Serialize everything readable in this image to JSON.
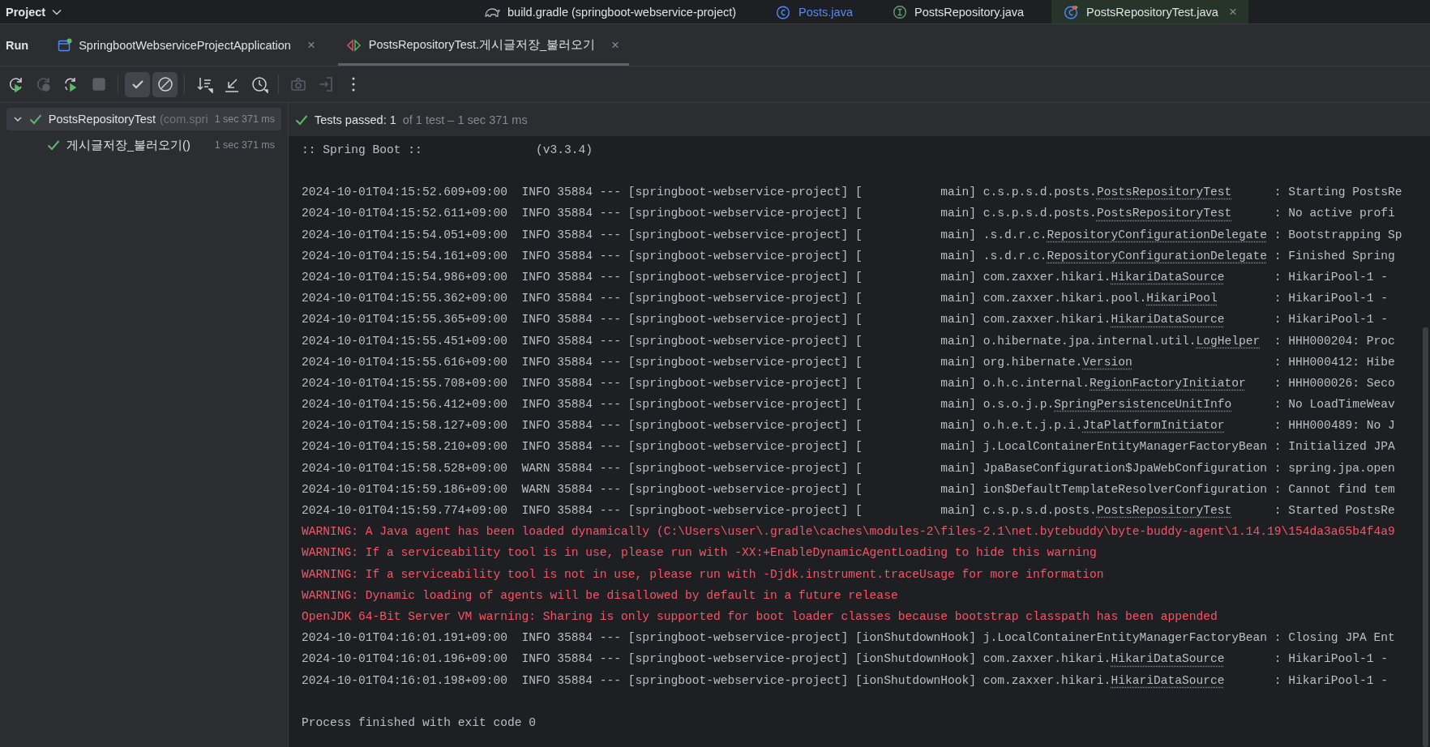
{
  "top_bar": {
    "project_label": "Project"
  },
  "editor_tabs": [
    {
      "label": "build.gradle (springboot-webservice-project)",
      "kind": "gradle",
      "selected": false,
      "link": false
    },
    {
      "label": "Posts.java",
      "kind": "class",
      "selected": false,
      "link": true
    },
    {
      "label": "PostsRepository.java",
      "kind": "interface",
      "selected": false,
      "link": false
    },
    {
      "label": "PostsRepositoryTest.java",
      "kind": "testclass",
      "selected": true,
      "link": false,
      "close": "×"
    }
  ],
  "run_bar": {
    "title": "Run",
    "tabs": [
      {
        "label": "SpringbootWebserviceProjectApplication",
        "kind": "app",
        "selected": false,
        "close": "×"
      },
      {
        "label": "PostsRepositoryTest.게시글저장_불러오기",
        "kind": "test",
        "selected": true,
        "close": "×"
      }
    ]
  },
  "toolbar": [
    {
      "kind": "rerun",
      "disabled": false,
      "on": false
    },
    {
      "kind": "rerun-failed",
      "disabled": true,
      "on": false
    },
    {
      "kind": "toggle-auto",
      "disabled": false,
      "on": false
    },
    {
      "kind": "stop",
      "disabled": true,
      "on": false
    },
    {
      "kind": "sep"
    },
    {
      "kind": "show-passed",
      "disabled": false,
      "on": true
    },
    {
      "kind": "show-ignored",
      "disabled": false,
      "on": true
    },
    {
      "kind": "sep"
    },
    {
      "kind": "sort",
      "disabled": false,
      "on": false
    },
    {
      "kind": "collapse",
      "disabled": false,
      "on": false
    },
    {
      "kind": "history",
      "disabled": false,
      "on": false
    },
    {
      "kind": "sep"
    },
    {
      "kind": "screenshot",
      "disabled": true,
      "on": false
    },
    {
      "kind": "export",
      "disabled": true,
      "on": false
    },
    {
      "kind": "more",
      "disabled": false,
      "on": false
    }
  ],
  "tree": [
    {
      "label": "PostsRepositoryTest",
      "detail": "(com.spri",
      "time": "1 sec 371 ms",
      "expanded": true,
      "selected": true,
      "passed": true,
      "children": [
        {
          "label": "게시글저장_불러오기()",
          "time": "1 sec 371 ms",
          "selected": false,
          "passed": true
        }
      ]
    }
  ],
  "status": {
    "label": "Tests passed: 1",
    "detail": "of 1 test – 1 sec 371 ms",
    "passed": true
  },
  "console": [
    {
      "kind": "banner",
      "text": ":: Spring Boot ::                (v3.3.4)"
    },
    {
      "kind": "log",
      "head": "2024-10-01T04:15:52.609+09:00  INFO 35884 --- [springboot-webservice-project] [           main] ",
      "pkg": "c.s.p.s.d.posts.",
      "cls": "PostsRepositoryTest",
      "msg": ": Starting PostsRe"
    },
    {
      "kind": "log",
      "head": "2024-10-01T04:15:52.611+09:00  INFO 35884 --- [springboot-webservice-project] [           main] ",
      "pkg": "c.s.p.s.d.posts.",
      "cls": "PostsRepositoryTest",
      "msg": ": No active profi"
    },
    {
      "kind": "log",
      "head": "2024-10-01T04:15:54.051+09:00  INFO 35884 --- [springboot-webservice-project] [           main] ",
      "pkg": ".s.d.r.c.",
      "cls": "RepositoryConfigurationDelegate",
      "msg": ": Bootstrapping Sp"
    },
    {
      "kind": "log",
      "head": "2024-10-01T04:15:54.161+09:00  INFO 35884 --- [springboot-webservice-project] [           main] ",
      "pkg": ".s.d.r.c.",
      "cls": "RepositoryConfigurationDelegate",
      "msg": ": Finished Spring"
    },
    {
      "kind": "log",
      "head": "2024-10-01T04:15:54.986+09:00  INFO 35884 --- [springboot-webservice-project] [           main] ",
      "pkg": "com.zaxxer.hikari.",
      "cls": "HikariDataSource",
      "msg": ": HikariPool-1 -"
    },
    {
      "kind": "log",
      "head": "2024-10-01T04:15:55.362+09:00  INFO 35884 --- [springboot-webservice-project] [           main] ",
      "pkg": "com.zaxxer.hikari.pool.",
      "cls": "HikariPool",
      "msg": ": HikariPool-1 -"
    },
    {
      "kind": "log",
      "head": "2024-10-01T04:15:55.365+09:00  INFO 35884 --- [springboot-webservice-project] [           main] ",
      "pkg": "com.zaxxer.hikari.",
      "cls": "HikariDataSource",
      "msg": ": HikariPool-1 -"
    },
    {
      "kind": "log",
      "head": "2024-10-01T04:15:55.451+09:00  INFO 35884 --- [springboot-webservice-project] [           main] ",
      "pkg": "o.hibernate.jpa.internal.util.",
      "cls": "LogHelper",
      "msg": ": HHH000204: Proc"
    },
    {
      "kind": "log",
      "head": "2024-10-01T04:15:55.616+09:00  INFO 35884 --- [springboot-webservice-project] [           main] ",
      "pkg": "org.hibernate.",
      "cls": "Version",
      "msg": ": HHH000412: Hibe"
    },
    {
      "kind": "log",
      "head": "2024-10-01T04:15:55.708+09:00  INFO 35884 --- [springboot-webservice-project] [           main] ",
      "pkg": "o.h.c.internal.",
      "cls": "RegionFactoryInitiator",
      "msg": ": HHH000026: Seco"
    },
    {
      "kind": "log",
      "head": "2024-10-01T04:15:56.412+09:00  INFO 35884 --- [springboot-webservice-project] [           main] ",
      "pkg": "o.s.o.j.p.",
      "cls": "SpringPersistenceUnitInfo",
      "msg": ": No LoadTimeWeav"
    },
    {
      "kind": "log",
      "head": "2024-10-01T04:15:58.127+09:00  INFO 35884 --- [springboot-webservice-project] [           main] ",
      "pkg": "o.h.e.t.j.p.i.",
      "cls": "JtaPlatformInitiator",
      "msg": ": HHH000489: No J"
    },
    {
      "kind": "log",
      "head": "2024-10-01T04:15:58.210+09:00  INFO 35884 --- [springboot-webservice-project] [           main] ",
      "pkg": "j.LocalContainerEntityManagerFactoryBean",
      "msg": ": Initialized JPA"
    },
    {
      "kind": "log",
      "head": "2024-10-01T04:15:58.528+09:00  WARN 35884 --- [springboot-webservice-project] [           main] ",
      "pkg": "JpaBaseConfiguration$JpaWebConfiguration",
      "msg": ": spring.jpa.open"
    },
    {
      "kind": "log",
      "head": "2024-10-01T04:15:59.186+09:00  WARN 35884 --- [springboot-webservice-project] [           main] ",
      "pkg": "ion$DefaultTemplateResolverConfiguration",
      "msg": ": Cannot find tem"
    },
    {
      "kind": "log",
      "head": "2024-10-01T04:15:59.774+09:00  INFO 35884 --- [springboot-webservice-project] [           main] ",
      "pkg": "c.s.p.s.d.posts.",
      "cls": "PostsRepositoryTest",
      "msg": ": Started PostsRe"
    },
    {
      "kind": "error",
      "text": "WARNING: A Java agent has been loaded dynamically (C:\\Users\\user\\.gradle\\caches\\modules-2\\files-2.1\\net.bytebuddy\\byte-buddy-agent\\1.14.19\\154da3a65b4f4a9"
    },
    {
      "kind": "error",
      "text": "WARNING: If a serviceability tool is in use, please run with -XX:+EnableDynamicAgentLoading to hide this warning"
    },
    {
      "kind": "error",
      "text": "WARNING: If a serviceability tool is not in use, please run with -Djdk.instrument.traceUsage for more information"
    },
    {
      "kind": "error",
      "text": "WARNING: Dynamic loading of agents will be disallowed by default in a future release"
    },
    {
      "kind": "error",
      "text": "OpenJDK 64-Bit Server VM warning: Sharing is only supported for boot loader classes because bootstrap classpath has been appended"
    },
    {
      "kind": "log",
      "head": "2024-10-01T04:16:01.191+09:00  INFO 35884 --- [springboot-webservice-project] [ionShutdownHook] ",
      "pkg": "j.LocalContainerEntityManagerFactoryBean",
      "msg": ": Closing JPA Ent"
    },
    {
      "kind": "log",
      "head": "2024-10-01T04:16:01.196+09:00  INFO 35884 --- [springboot-webservice-project] [ionShutdownHook] ",
      "pkg": "com.zaxxer.hikari.",
      "cls": "HikariDataSource",
      "msg": ": HikariPool-1 -"
    },
    {
      "kind": "log",
      "head": "2024-10-01T04:16:01.198+09:00  INFO 35884 --- [springboot-webservice-project] [ionShutdownHook] ",
      "pkg": "com.zaxxer.hikari.",
      "cls": "HikariDataSource",
      "msg": ": HikariPool-1 -"
    },
    {
      "kind": "exit",
      "text": "Process finished with exit code 0"
    }
  ]
}
